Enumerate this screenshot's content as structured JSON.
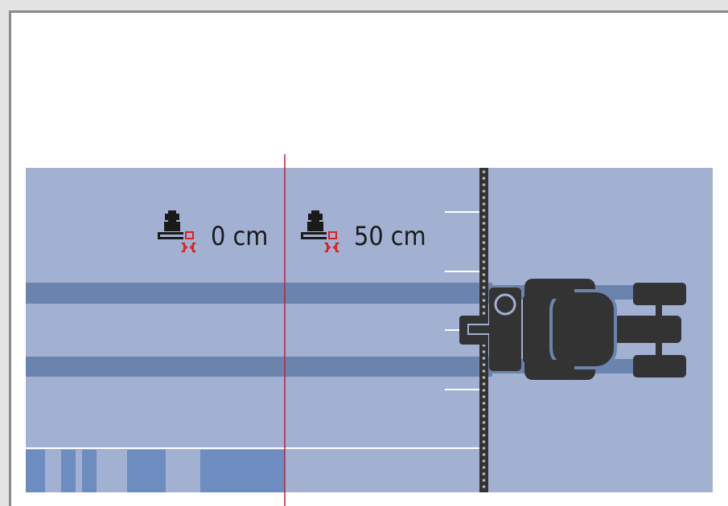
{
  "diagram": {
    "labels": {
      "left_offset": "0 cm",
      "right_offset": "50 cm"
    },
    "icons": {
      "left": "tractor-implement-offset-icon",
      "right": "tractor-implement-offset-icon"
    },
    "colors": {
      "field": "#a2b0d2",
      "track_stripe": "#6b84ad",
      "coverage": "#6d8cbf",
      "divider_line": "#c0203a",
      "boom": "#333333",
      "tractor": "#333333",
      "icon_red": "#e02020",
      "icon_black": "#1a1a1a"
    }
  }
}
